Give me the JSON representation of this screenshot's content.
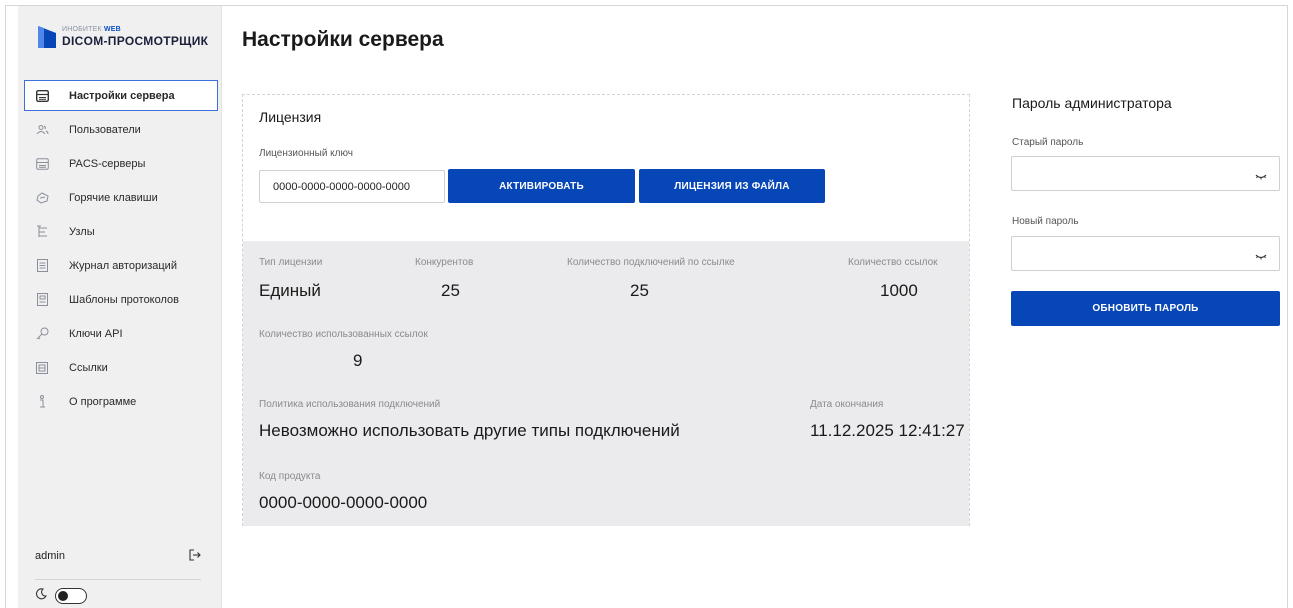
{
  "brand": {
    "small_prefix": "ИНОБИТЕК",
    "small_suffix": "WEB",
    "name": "DICOM-ПРОСМОТРЩИК",
    "accent_color": "#0646b7"
  },
  "sidebar": {
    "items": [
      {
        "label": "Настройки сервера",
        "icon": "server-icon",
        "active": true
      },
      {
        "label": "Пользователи",
        "icon": "users-icon",
        "active": false
      },
      {
        "label": "PACS-серверы",
        "icon": "server-icon",
        "active": false
      },
      {
        "label": "Горячие клавиши",
        "icon": "keyboard-icon",
        "active": false
      },
      {
        "label": "Узлы",
        "icon": "nodes-icon",
        "active": false
      },
      {
        "label": "Журнал авторизаций",
        "icon": "log-icon",
        "active": false
      },
      {
        "label": "Шаблоны протоколов",
        "icon": "template-icon",
        "active": false
      },
      {
        "label": "Ключи API",
        "icon": "key-icon",
        "active": false
      },
      {
        "label": "Ссылки",
        "icon": "link-icon",
        "active": false
      },
      {
        "label": "О программе",
        "icon": "info-icon",
        "active": false
      }
    ],
    "user": "admin"
  },
  "page": {
    "title": "Настройки сервера"
  },
  "license": {
    "heading": "Лицензия",
    "key_label": "Лицензионный ключ",
    "key_value": "0000-0000-0000-0000-0000",
    "activate_label": "АКТИВИРОВАТЬ",
    "file_label": "ЛИЦЕНЗИЯ ИЗ ФАЙЛА",
    "type_label": "Тип лицензии",
    "type_value": "Единый",
    "concurrent_label": "Конкурентов",
    "concurrent_value": "25",
    "link_conn_label": "Количество подключений по ссылке",
    "link_conn_value": "25",
    "links_label": "Количество ссылок",
    "links_value": "1000",
    "used_links_label": "Количество использованных ссылок",
    "used_links_value": "9",
    "policy_label": "Политика использования подключений",
    "policy_value": "Невозможно использовать другие типы подключений",
    "expiry_label": "Дата окончания",
    "expiry_value": "11.12.2025 12:41:27",
    "product_label": "Код продукта",
    "product_value": "0000-0000-0000-0000"
  },
  "password": {
    "heading": "Пароль администратора",
    "old_label": "Старый пароль",
    "new_label": "Новый пароль",
    "update_label": "ОБНОВИТЬ ПАРОЛЬ"
  }
}
